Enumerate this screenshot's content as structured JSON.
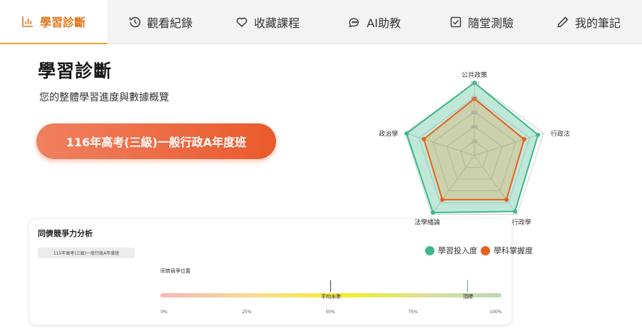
{
  "tabs": [
    {
      "label": "學習診斷",
      "icon": "bar-chart-icon",
      "active": true
    },
    {
      "label": "觀看紀錄",
      "icon": "history-icon",
      "active": false
    },
    {
      "label": "收藏課程",
      "icon": "heart-icon",
      "active": false
    },
    {
      "label": "AI助教",
      "icon": "chat-icon",
      "active": false
    },
    {
      "label": "隨堂測驗",
      "icon": "checkbox-icon",
      "active": false
    },
    {
      "label": "我的筆記",
      "icon": "pencil-icon",
      "active": false
    }
  ],
  "header": {
    "title": "學習診斷",
    "subtitle": "您的整體學習進度與數據概覽"
  },
  "course_button": "116年高考(三級)一般行政A年度班",
  "competition": {
    "title": "同儕競爭力分析",
    "course_chip": "115年高考(三級)一般行政A年度班",
    "position_label": "同儕競爭位置",
    "avg_label": "平均水準",
    "top_label": "頂標",
    "ticks": [
      "0%",
      "25%",
      "50%",
      "75%",
      "100%"
    ]
  },
  "colors": {
    "accent": "#e3761c",
    "investment": "#3ab889",
    "mastery": "#e8601c"
  },
  "chart_data": {
    "type": "radar",
    "axes": [
      "公共政策",
      "行政法",
      "行政學",
      "法學緒論",
      "政治學"
    ],
    "range": [
      0,
      100
    ],
    "ticks": [
      "20",
      "40",
      "60",
      "80",
      "100"
    ],
    "series": [
      {
        "name": "學習投入度",
        "values": [
          100,
          92,
          95,
          97,
          98
        ]
      },
      {
        "name": "學科掌握度",
        "values": [
          78,
          72,
          75,
          75,
          73
        ]
      }
    ],
    "legend_position": "bottom"
  }
}
